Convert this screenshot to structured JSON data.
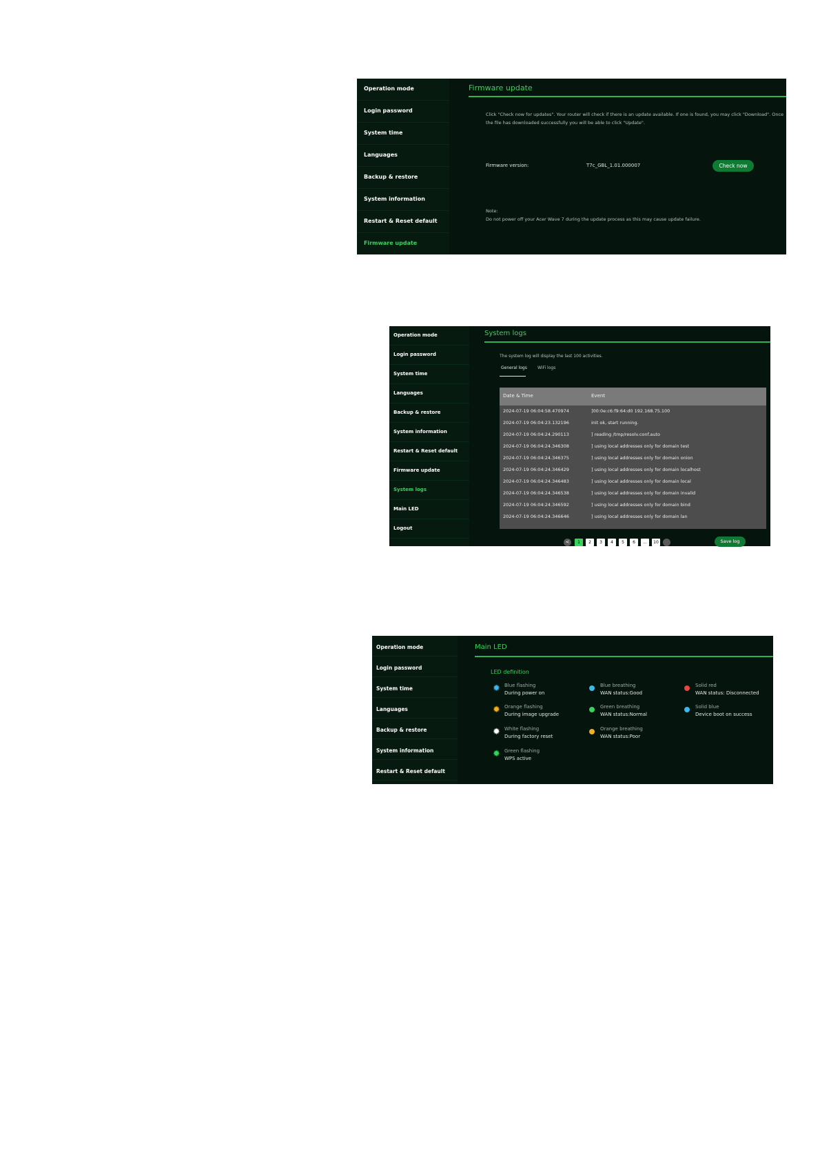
{
  "sidebar_labels": {
    "operation_mode": "Operation mode",
    "login_password": "Login password",
    "system_time": "System time",
    "languages": "Languages",
    "backup_restore": "Backup & restore",
    "system_information": "System information",
    "restart_reset": "Restart & Reset default",
    "firmware_update": "Firmware update",
    "system_logs": "System logs",
    "main_led": "Main LED",
    "logout": "Logout"
  },
  "firmware": {
    "title": "Firmware update",
    "instructions_1": "Click \"Check now for updates\". Your router will check if there is an update available. If one is found, you may click \"Download\". Once",
    "instructions_2": "the file has downloaded successfully you will be able to click \"Update\".",
    "version_label": "Firmware version:",
    "version_value": "T7c_GBL_1.01.000007",
    "check_button": "Check now",
    "note_label": "Note:",
    "note_text": "Do not power off your Acer Wave 7 during the update process as this may cause update failure."
  },
  "logs": {
    "title": "System logs",
    "description": "The system log will display the last 100 activities.",
    "tab_general": "General logs",
    "tab_wifi": "WiFi logs",
    "col_date": "Date & Time",
    "col_event": "Event",
    "rows": [
      {
        "date": "2024-07-19 06:04:58.470974",
        "event": "]00:0e:c6:f9:64:d0 192.168.75.100"
      },
      {
        "date": "2024-07-19 06:04:23.132196",
        "event": "init ok, start running."
      },
      {
        "date": "2024-07-19 06:04:24.290113",
        "event": "] reading /tmp/resolv.conf.auto"
      },
      {
        "date": "2024-07-19 06:04:24.346308",
        "event": "] using local addresses only for domain test"
      },
      {
        "date": "2024-07-19 06:04:24.346375",
        "event": "] using local addresses only for domain onion"
      },
      {
        "date": "2024-07-19 06:04:24.346429",
        "event": "] using local addresses only for domain localhost"
      },
      {
        "date": "2024-07-19 06:04:24.346483",
        "event": "] using local addresses only for domain local"
      },
      {
        "date": "2024-07-19 06:04:24.346538",
        "event": "] using local addresses only for domain invalid"
      },
      {
        "date": "2024-07-19 06:04:24.346592",
        "event": "] using local addresses only for domain bind"
      },
      {
        "date": "2024-07-19 06:04:24.346646",
        "event": "] using local addresses only for domain lan"
      }
    ],
    "pages": [
      "1",
      "2",
      "3",
      "4",
      "5",
      "6",
      "...",
      "10"
    ],
    "current_page": "1",
    "prev_label": "<",
    "save_button": "Save log"
  },
  "led": {
    "title": "Main LED",
    "subtitle": "LED definition",
    "items": [
      {
        "name": "Blue flashing",
        "desc": "During power on",
        "color": "#3db8e8",
        "icon": "star-flash"
      },
      {
        "name": "Orange flashing",
        "desc": "During image upgrade",
        "color": "#f0b020",
        "icon": "star-flash"
      },
      {
        "name": "White flashing",
        "desc": "During factory reset",
        "color": "#ffffff",
        "icon": "star-flash"
      },
      {
        "name": "Green flashing",
        "desc": "WPS active",
        "color": "#36d45a",
        "icon": "star-flash"
      },
      {
        "name": "Blue breathing",
        "desc": "WAN status:Good",
        "color": "#3db8e8",
        "icon": "dot"
      },
      {
        "name": "Green breathing",
        "desc": "WAN status:Normal",
        "color": "#36d45a",
        "icon": "dot"
      },
      {
        "name": "Orange breathing",
        "desc": "WAN status:Poor",
        "color": "#f0b020",
        "icon": "dot"
      },
      {
        "name": "Solid red",
        "desc": "WAN status: Disconnected",
        "color": "#e84545",
        "icon": "dot"
      },
      {
        "name": "Solid blue",
        "desc": "Device boot on success",
        "color": "#3db8e8",
        "icon": "dot"
      }
    ]
  },
  "colors": {
    "accent_green": "#36d45a",
    "panel_bg": "#05140d",
    "button_green": "#0f7a33"
  }
}
